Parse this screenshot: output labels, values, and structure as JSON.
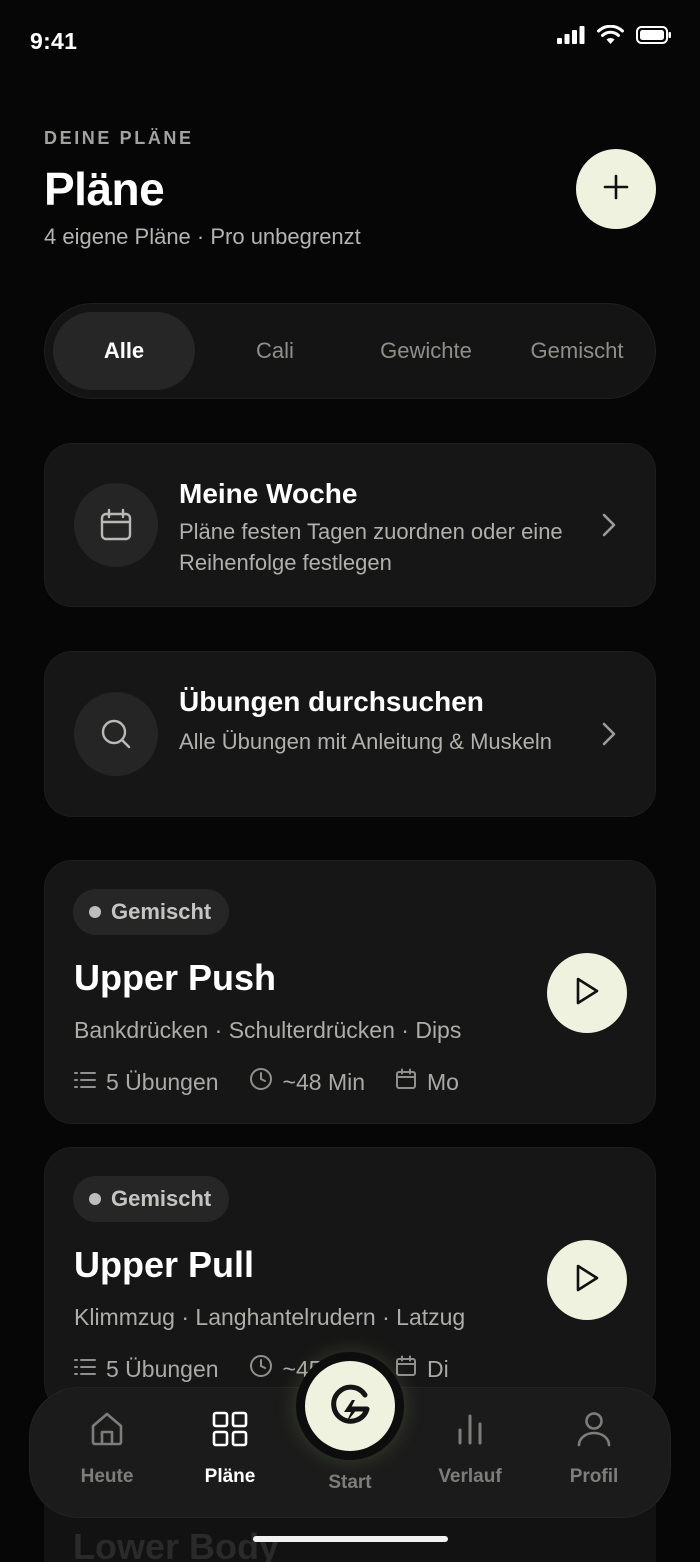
{
  "status_bar": {
    "time": "9:41"
  },
  "header": {
    "eyebrow": "DEINE PLÄNE",
    "title": "Pläne",
    "subtitle": "4 eigene Pläne · Pro unbegrenzt"
  },
  "filters": {
    "tabs": [
      {
        "label": "Alle",
        "active": true
      },
      {
        "label": "Cali",
        "active": false
      },
      {
        "label": "Gewichte",
        "active": false
      },
      {
        "label": "Gemischt",
        "active": false
      }
    ]
  },
  "week_card": {
    "icon": "calendar-icon",
    "title": "Meine Woche",
    "description": "Pläne festen Tagen zuordnen oder eine Reihenfolge festlegen"
  },
  "search_card": {
    "icon": "search-icon",
    "title": "Übungen durchsuchen",
    "description": "Alle Übungen mit Anleitung & Muskeln"
  },
  "plans": [
    {
      "badge": "Gemischt",
      "title": "Upper Push",
      "exercises": "Bankdrücken · Schulterdrücken · Dips",
      "count": "5 Übungen",
      "duration": "~48 Min",
      "day": "Mo"
    },
    {
      "badge": "Gemischt",
      "title": "Upper Pull",
      "exercises": "Klimmzug · Langhantelrudern · Latzug",
      "count": "5 Übungen",
      "duration": "~45 Min",
      "day": "Di"
    }
  ],
  "peek_plan": {
    "title": "Lower Body"
  },
  "tab_bar": {
    "items": [
      {
        "label": "Heute",
        "icon": "home-icon",
        "active": false
      },
      {
        "label": "Pläne",
        "icon": "grid-icon",
        "active": true
      },
      {
        "label": "Start",
        "icon": "bolt-logo-icon",
        "active": false
      },
      {
        "label": "Verlauf",
        "icon": "bar-chart-icon",
        "active": false
      },
      {
        "label": "Profil",
        "icon": "user-icon",
        "active": false
      }
    ]
  },
  "colors": {
    "background": "#060606",
    "card": "#161616",
    "accent": "#eff2de",
    "text_muted": "#b0b0ad"
  }
}
